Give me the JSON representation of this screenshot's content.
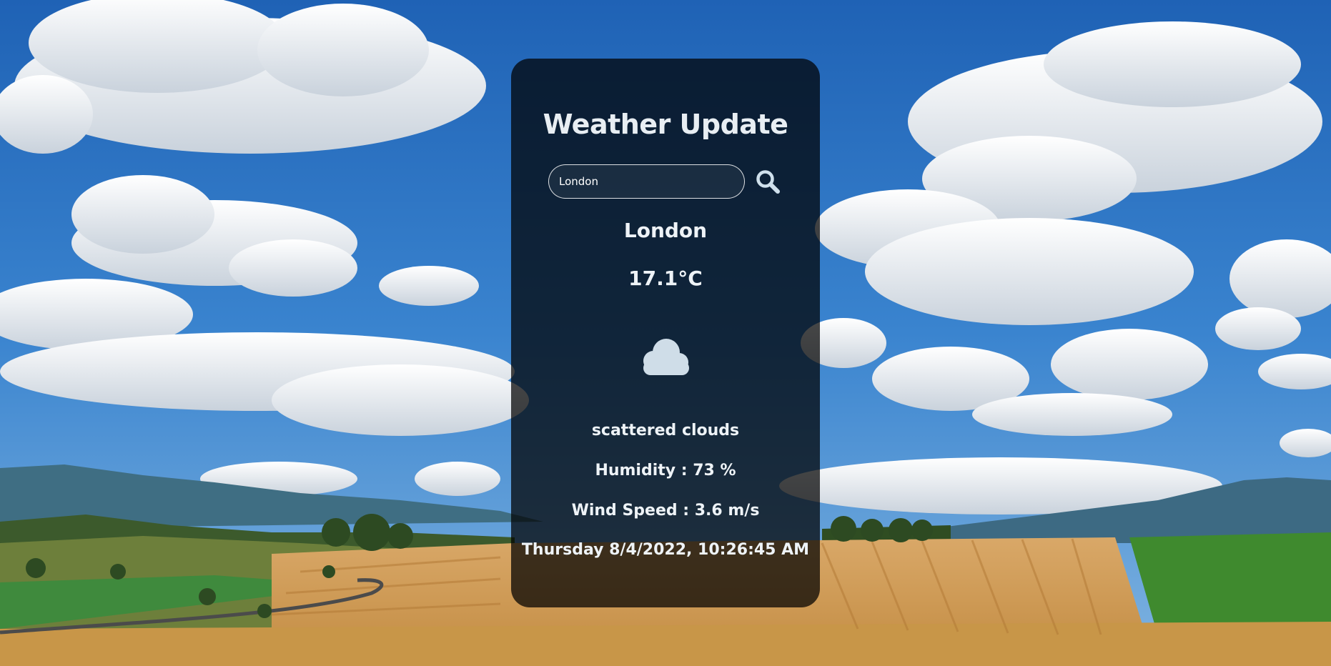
{
  "card": {
    "title": "Weather Update",
    "search": {
      "value": "London",
      "placeholder": ""
    },
    "city": "London",
    "temperature": "17.1°C",
    "condition_icon": "cloud-icon",
    "description": "scattered clouds",
    "humidity": "Humidity : 73 %",
    "wind_speed": "Wind Speed : 3.6 m/s",
    "datetime": "Thursday 8/4/2022, 10:26:45 AM"
  },
  "colors": {
    "sky": "#2f74c4",
    "card_bg": "#000000",
    "icon": "#cfdde8",
    "text": "#eef3f7"
  }
}
